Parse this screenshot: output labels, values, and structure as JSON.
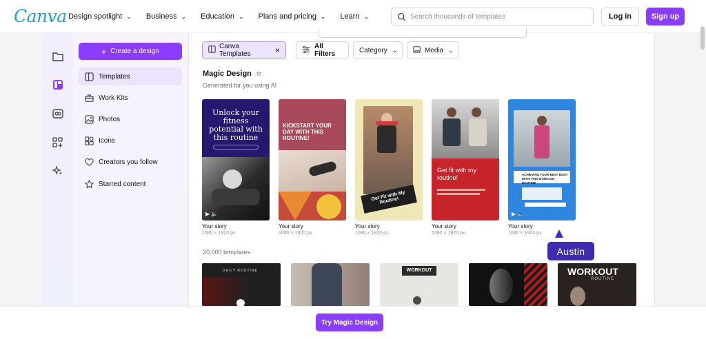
{
  "brand": {
    "logo": "Canva",
    "accent": "#8b3dff"
  },
  "nav": {
    "items": [
      {
        "label": "Design spotlight"
      },
      {
        "label": "Business"
      },
      {
        "label": "Education"
      },
      {
        "label": "Plans and pricing"
      },
      {
        "label": "Learn"
      }
    ],
    "search_placeholder": "Search thousands of templates",
    "login": "Log in",
    "signup": "Sign up"
  },
  "sidebar": {
    "create_button": "Create a design",
    "items": [
      {
        "label": "Templates",
        "icon": "template-icon",
        "active": true
      },
      {
        "label": "Work Kits",
        "icon": "briefcase-icon"
      },
      {
        "label": "Photos",
        "icon": "photo-icon"
      },
      {
        "label": "Icons",
        "icon": "shapes-icon"
      },
      {
        "label": "Creators you follow",
        "icon": "heart-icon"
      },
      {
        "label": "Starred content",
        "icon": "star-icon"
      }
    ]
  },
  "rail": {
    "icons": [
      "folder-icon",
      "templates-icon",
      "brand-icon",
      "apps-icon",
      "magic-icon"
    ]
  },
  "filters": {
    "active_chip": "Canva Templates",
    "all_filters": "All Filters",
    "category": "Category",
    "media": "Media"
  },
  "magic": {
    "title": "Magic Design",
    "subtitle": "Generated for you using AI",
    "cards": [
      {
        "title": "Your story",
        "size": "1080 × 1920 px",
        "overlay": "Unlock your fitness potential with this routine"
      },
      {
        "title": "Your story",
        "size": "1080 × 1920 px",
        "overlay": "KICKSTART YOUR DAY WITH THIS ROUTINE!"
      },
      {
        "title": "Your story",
        "size": "1080 × 1920 px",
        "overlay": "Get Fit with My Routine!"
      },
      {
        "title": "Your story",
        "size": "1080 × 1920 px",
        "overlay": "Get fit with my routine!"
      },
      {
        "title": "Your story",
        "size": "1080 × 1920 px",
        "overlay": "ACHIEVING YOUR BEST BODY WITH THIS WORKOUT ROUTINE"
      }
    ]
  },
  "templates": {
    "count": "20,000 templates",
    "thumbs": [
      {
        "text": "DAILY ROUTINE"
      },
      {
        "text": ""
      },
      {
        "text": "WORKOUT"
      },
      {
        "text": ""
      },
      {
        "text": "WORKOUT",
        "sub": "ROUTINE"
      }
    ]
  },
  "collaborator": {
    "name": "Austin"
  },
  "footer": {
    "cta": "Try Magic Design"
  }
}
